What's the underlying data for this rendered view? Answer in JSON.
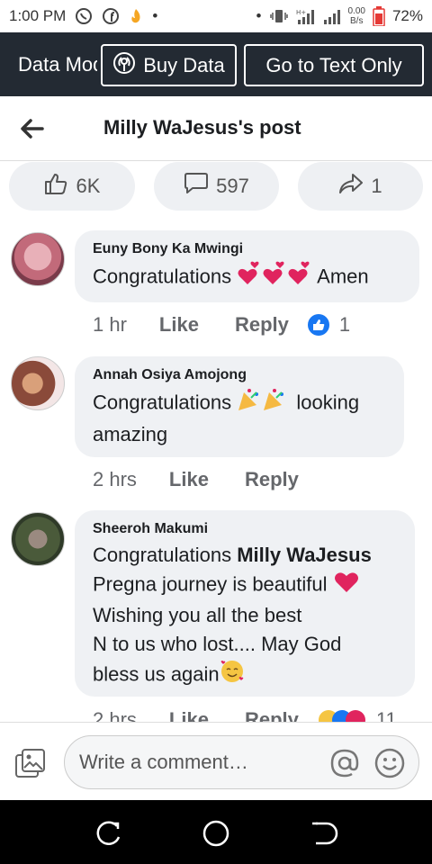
{
  "status_bar": {
    "time": "1:00 PM",
    "speed_top": "0.00",
    "speed_bottom": "B/s",
    "battery": "72%"
  },
  "data_bar": {
    "mode_text": "Data Mode",
    "buy_data_label": "Buy Data",
    "text_only_label": "Go to Text Only"
  },
  "header": {
    "title": "Milly WaJesus's post"
  },
  "reactions": {
    "likes": "6K",
    "comments": "597",
    "shares": "1"
  },
  "comments": [
    {
      "name": "Euny Bony Ka Mwingi",
      "text_before": "Congratulations",
      "text_after": "Amen",
      "time": "1 hr",
      "like_label": "Like",
      "reply_label": "Reply",
      "reaction_count": "1"
    },
    {
      "name": "Annah Osiya Amojong",
      "text_before": "Congratulations",
      "text_after": "looking",
      "text_line2": "amazing",
      "time": "2 hrs",
      "like_label": "Like",
      "reply_label": "Reply"
    },
    {
      "name": "Sheeroh Makumi",
      "line1_prefix": "Congratulations",
      "line1_mention": "Milly WaJesus",
      "line2": "Pregna journey is beautiful",
      "line3": "Wishing you all the best",
      "line4": "N to us who lost.... May God",
      "line5": "bless us again",
      "time": "2 hrs",
      "like_label": "Like",
      "reply_label": "Reply",
      "reaction_count": "11"
    }
  ],
  "composer": {
    "placeholder": "Write a comment…"
  },
  "colors": {
    "data_bar_bg": "#232a33",
    "pill_bg": "#eef0f3",
    "bubble_bg": "#eff1f4",
    "like_blue": "#1877f2",
    "heart_red": "#e0245e"
  }
}
